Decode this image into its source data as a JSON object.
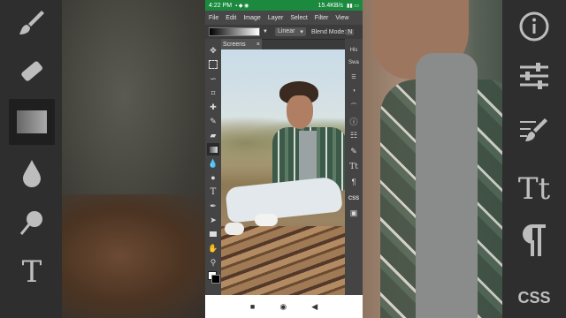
{
  "status_bar": {
    "time": "4:22 PM",
    "network": "15.4KB/s"
  },
  "menu": [
    "File",
    "Edit",
    "Image",
    "Layer",
    "Select",
    "Filter",
    "View"
  ],
  "options_bar": {
    "gradient_type": "Linear",
    "blend_label": "Blend Mode:",
    "blend_value": "N"
  },
  "document": {
    "tab_title": "Screens",
    "close_label": "×"
  },
  "panel_labels": {
    "history": "His",
    "swatches": "Swa",
    "css": "CSS"
  },
  "bg_right_labels": {
    "text": "Tt",
    "css": "CSS"
  },
  "bg_left_labels": {
    "type": "T"
  },
  "colors": {
    "status_bar": "#1b8a3e",
    "ui_dark": "#444444"
  },
  "icons": {
    "tools": [
      "move-icon",
      "marquee-icon",
      "lasso-icon",
      "crop-icon",
      "healing-icon",
      "brush-icon",
      "eraser-icon",
      "gradient-icon",
      "blur-icon",
      "dodge-icon",
      "type-icon",
      "pen-icon",
      "path-select-icon",
      "shape-icon",
      "hand-icon",
      "zoom-icon",
      "color-swatch-icon"
    ]
  }
}
